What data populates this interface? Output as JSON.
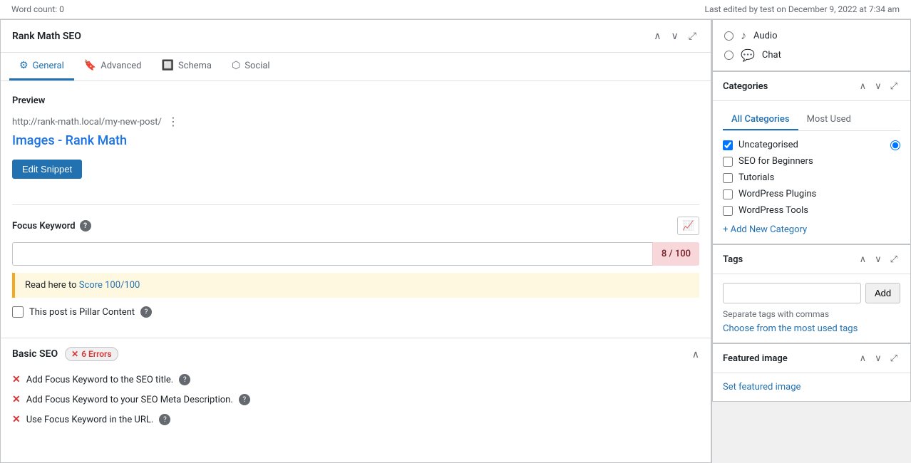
{
  "top_bar": {
    "word_count_label": "Word count: 0",
    "last_edited": "Last edited by test on December 9, 2022 at 7:34 am"
  },
  "post_formats": {
    "items": [
      {
        "label": "Audio",
        "icon": "♪"
      },
      {
        "label": "Chat",
        "icon": "💬"
      }
    ]
  },
  "rank_math": {
    "title": "Rank Math SEO",
    "tabs": [
      {
        "label": "General",
        "icon": "⚙",
        "active": true
      },
      {
        "label": "Advanced",
        "icon": "🔖",
        "active": false
      },
      {
        "label": "Schema",
        "icon": "🔲",
        "active": false
      },
      {
        "label": "Social",
        "icon": "⬡",
        "active": false
      }
    ],
    "preview": {
      "section_label": "Preview",
      "url": "http://rank-math.local/my-new-post/",
      "post_title": "Images - Rank Math",
      "edit_snippet_label": "Edit Snippet"
    },
    "focus_keyword": {
      "label": "Focus Keyword",
      "score": "8 / 100",
      "alert_text": "Read here to ",
      "alert_link_text": "Score 100/100",
      "alert_link_href": "#"
    },
    "pillar_content": {
      "label": "This post is Pillar Content"
    },
    "basic_seo": {
      "label": "Basic SEO",
      "error_count": "6 Errors",
      "errors": [
        {
          "text": "Add Focus Keyword to the SEO title."
        },
        {
          "text": "Add Focus Keyword to your SEO Meta Description."
        },
        {
          "text": "Use Focus Keyword in the URL."
        }
      ]
    }
  },
  "categories": {
    "title": "Categories",
    "tabs": [
      {
        "label": "All Categories",
        "active": true
      },
      {
        "label": "Most Used",
        "active": false
      }
    ],
    "items": [
      {
        "label": "Uncategorised",
        "checked": true,
        "radio": true
      },
      {
        "label": "SEO for Beginners",
        "checked": false,
        "radio": false
      },
      {
        "label": "Tutorials",
        "checked": false,
        "radio": false
      },
      {
        "label": "WordPress Plugins",
        "checked": false,
        "radio": false
      },
      {
        "label": "WordPress Tools",
        "checked": false,
        "radio": false
      }
    ],
    "add_new_label": "+ Add New Category"
  },
  "tags": {
    "title": "Tags",
    "input_placeholder": "",
    "add_button_label": "Add",
    "separator_text": "Separate tags with commas",
    "most_used_label": "Choose from the most used tags"
  },
  "featured_image": {
    "title": "Featured image",
    "set_label": "Set featured image"
  }
}
